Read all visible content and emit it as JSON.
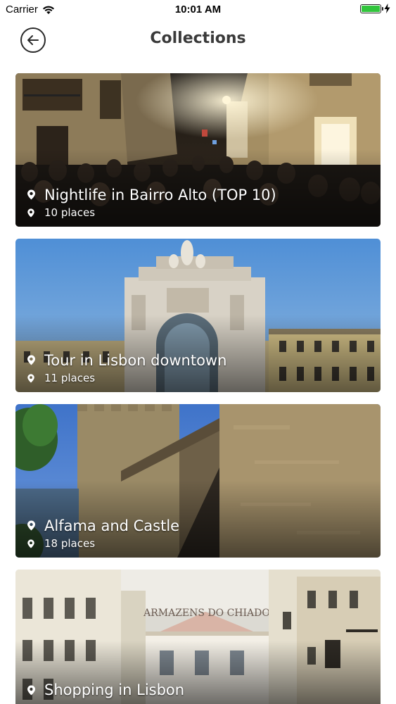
{
  "status_bar": {
    "carrier": "Carrier",
    "time": "10:01 AM",
    "battery_level": 1.0,
    "battery_color": "#31c53c"
  },
  "header": {
    "title": "Collections",
    "back_icon": "arrow-left-circle-icon"
  },
  "collections": [
    {
      "title": "Nightlife in Bairro Alto (TOP 10)",
      "count": "10 places"
    },
    {
      "title": "Tour in Lisbon downtown",
      "count": "11 places"
    },
    {
      "title": "Alfama and Castle",
      "count": "18 places"
    },
    {
      "title": "Shopping in Lisbon",
      "count": ""
    }
  ],
  "photo_sign_text": "ARMAZENS DO CHIADO"
}
